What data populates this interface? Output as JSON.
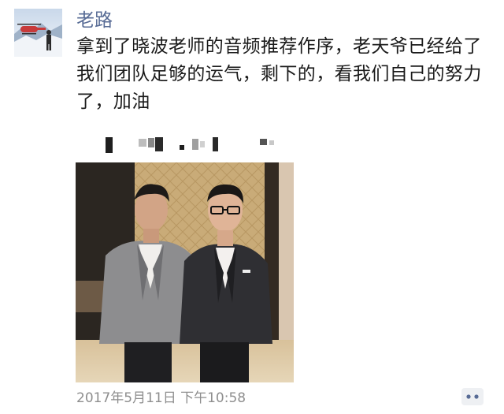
{
  "post": {
    "username": "老路",
    "text": "拿到了晓波老师的音频推荐作序，老天爷已经给了我们团队足够的运气，剩下的，看我们自己的努力了，加油",
    "timestamp": "2017年5月11日 下午10:58"
  },
  "colors": {
    "username": "#576b95",
    "text": "#1a1a1a",
    "timestamp": "#8e8e8e",
    "comment_button_bg": "#eef0f3",
    "comment_dots": "#576b95"
  },
  "icons": {
    "comment": "more-dots-icon"
  }
}
